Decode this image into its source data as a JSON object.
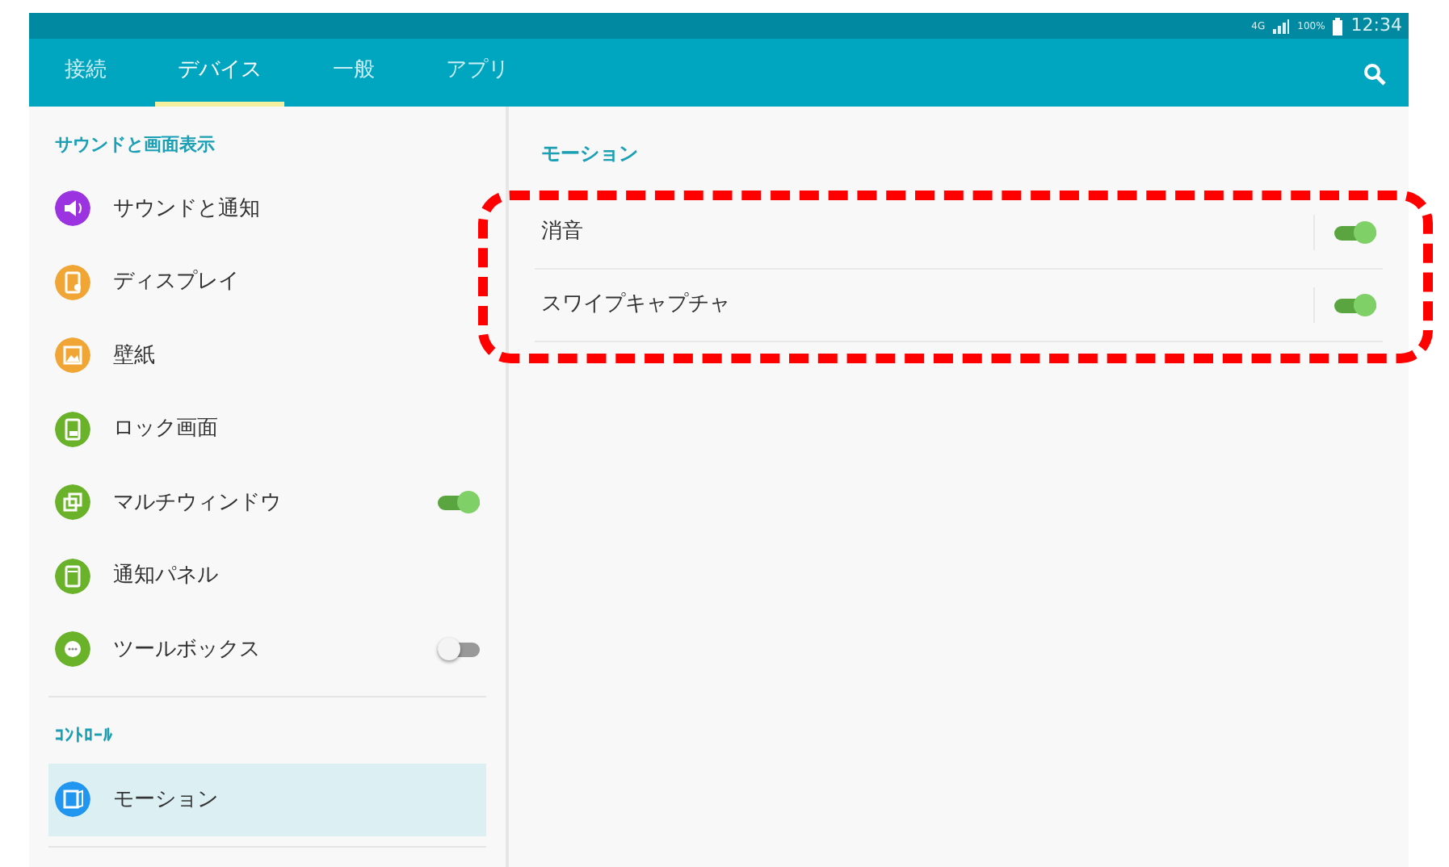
{
  "status_bar": {
    "network": "4G",
    "battery": "100%",
    "time": "12:34"
  },
  "tabs": [
    {
      "label": "接続",
      "selected": false
    },
    {
      "label": "デバイス",
      "selected": true
    },
    {
      "label": "一般",
      "selected": false
    },
    {
      "label": "アプリ",
      "selected": false
    }
  ],
  "sidebar": {
    "sections": [
      {
        "title": "サウンドと画面表示",
        "items": [
          {
            "label": "サウンドと通知",
            "kind": "plain",
            "color": "#9c33e0",
            "selected": false
          },
          {
            "label": "ディスプレイ",
            "kind": "plain",
            "color": "#f0a535",
            "selected": false
          },
          {
            "label": "壁紙",
            "kind": "plain",
            "color": "#f0a535",
            "selected": false
          },
          {
            "label": "ロック画面",
            "kind": "plain",
            "color": "#6ab22a",
            "selected": false
          },
          {
            "label": "マルチウィンドウ",
            "kind": "switch",
            "on": true,
            "color": "#6ab22a",
            "selected": false
          },
          {
            "label": "通知パネル",
            "kind": "plain",
            "color": "#6ab22a",
            "selected": false
          },
          {
            "label": "ツールボックス",
            "kind": "switch",
            "on": false,
            "color": "#6ab22a",
            "selected": false
          }
        ]
      },
      {
        "title": "ｺﾝﾄﾛｰﾙ",
        "items": [
          {
            "label": "モーション",
            "kind": "plain",
            "color": "#2196f0",
            "selected": true
          }
        ]
      }
    ]
  },
  "detail": {
    "title": "モーション",
    "rows": [
      {
        "label": "消音",
        "on": true
      },
      {
        "label": "スワイプキャプチャ",
        "on": true
      }
    ]
  }
}
